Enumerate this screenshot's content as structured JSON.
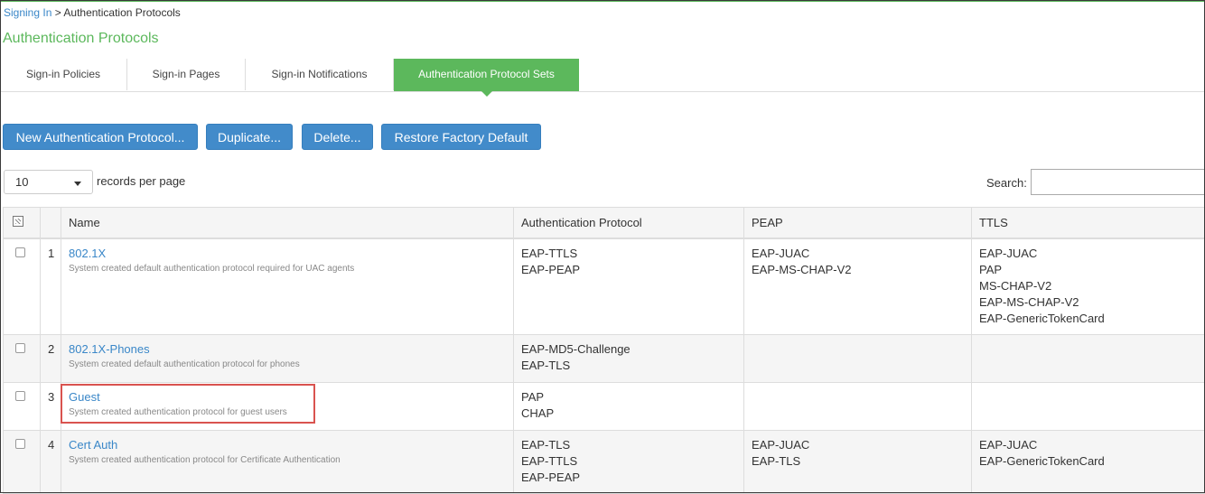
{
  "breadcrumb": {
    "parent": "Signing In",
    "separator": " > ",
    "current": "Authentication Protocols"
  },
  "page_title": "Authentication Protocols",
  "tabs": [
    {
      "label": "Sign-in Policies"
    },
    {
      "label": "Sign-in Pages"
    },
    {
      "label": "Sign-in Notifications"
    },
    {
      "label": "Authentication Protocol Sets",
      "active": true
    }
  ],
  "toolbar": {
    "new_label": "New Authentication Protocol...",
    "duplicate_label": "Duplicate...",
    "delete_label": "Delete...",
    "restore_label": "Restore Factory Default"
  },
  "paging": {
    "records_value": "10",
    "records_label": "records per page"
  },
  "search": {
    "label": "Search:",
    "value": ""
  },
  "table": {
    "columns": [
      "Name",
      "Authentication Protocol",
      "PEAP",
      "TTLS"
    ],
    "rows": [
      {
        "num": "1",
        "name": "802.1X",
        "desc": "System created default authentication protocol required for UAC agents",
        "auth": [
          "EAP-TTLS",
          "EAP-PEAP"
        ],
        "peap": [
          "EAP-JUAC",
          "EAP-MS-CHAP-V2"
        ],
        "ttls": [
          "EAP-JUAC",
          "PAP",
          "MS-CHAP-V2",
          "EAP-MS-CHAP-V2",
          "EAP-GenericTokenCard"
        ]
      },
      {
        "num": "2",
        "name": "802.1X-Phones",
        "desc": "System created default authentication protocol for phones",
        "auth": [
          "EAP-MD5-Challenge",
          "EAP-TLS"
        ],
        "peap": [],
        "ttls": []
      },
      {
        "num": "3",
        "name": "Guest",
        "desc": "System created authentication protocol for guest users",
        "auth": [
          "PAP",
          "CHAP"
        ],
        "peap": [],
        "ttls": []
      },
      {
        "num": "4",
        "name": "Cert Auth",
        "desc": "System created authentication protocol for Certificate Authentication",
        "auth": [
          "EAP-TLS",
          "EAP-TTLS",
          "EAP-PEAP"
        ],
        "peap": [
          "EAP-JUAC",
          "EAP-TLS"
        ],
        "ttls": [
          "EAP-JUAC",
          "EAP-GenericTokenCard"
        ]
      }
    ]
  },
  "colors": {
    "accent_green": "#5cb85c",
    "button_blue": "#428bca",
    "link_blue": "#3a87c8",
    "highlight_red": "#d9534f"
  }
}
